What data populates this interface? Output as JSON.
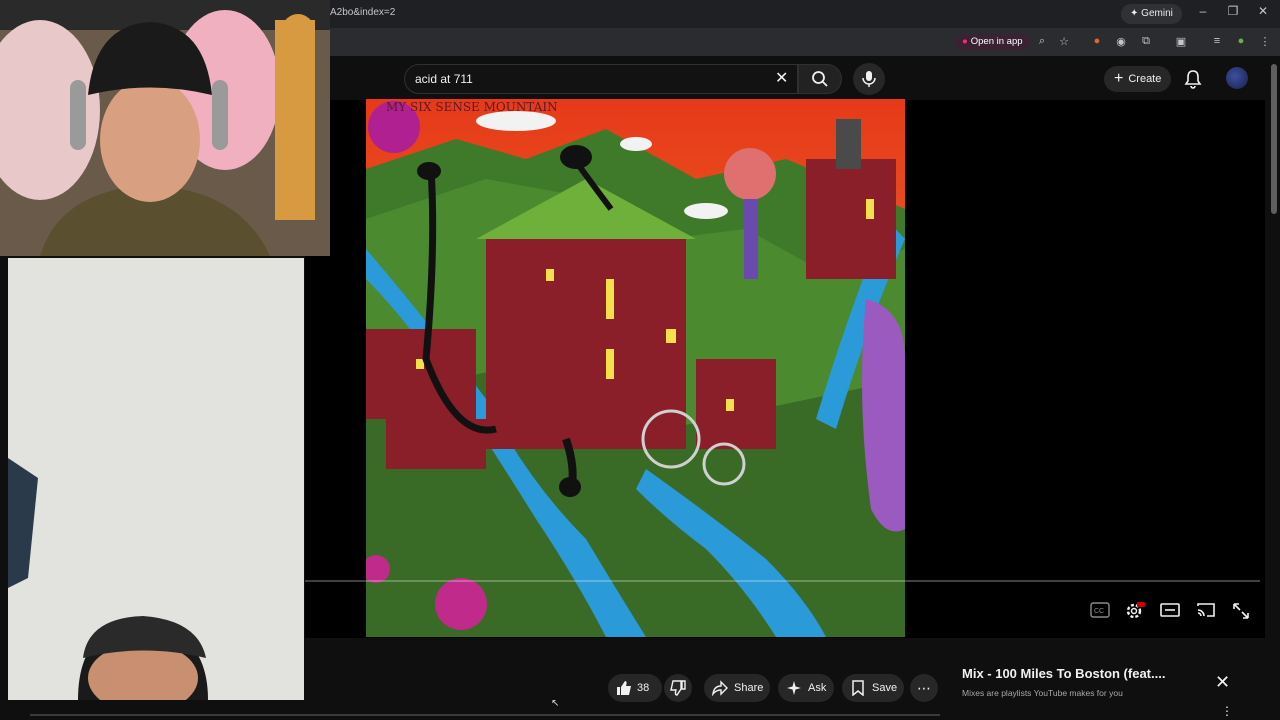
{
  "browser": {
    "url_fragment": "A2bo&index=2",
    "gemini_label": "Gemini",
    "open_in_app_label": "Open in app"
  },
  "youtube": {
    "search_value": "acid at 711",
    "create_label": "Create"
  },
  "video": {
    "cover_text": "MY SIX SENSE MOUNTAIN"
  },
  "actions": {
    "like_count": "38",
    "share_label": "Share",
    "ask_label": "Ask",
    "save_label": "Save"
  },
  "mix": {
    "title": "Mix - 100 Miles To Boston (feat....",
    "subtitle": "Mixes are playlists YouTube makes for you"
  },
  "colors": {
    "youtube_bg": "#0f0f0f",
    "pill_bg": "#272727",
    "open_in_app_dot": "#ff2a6a"
  }
}
